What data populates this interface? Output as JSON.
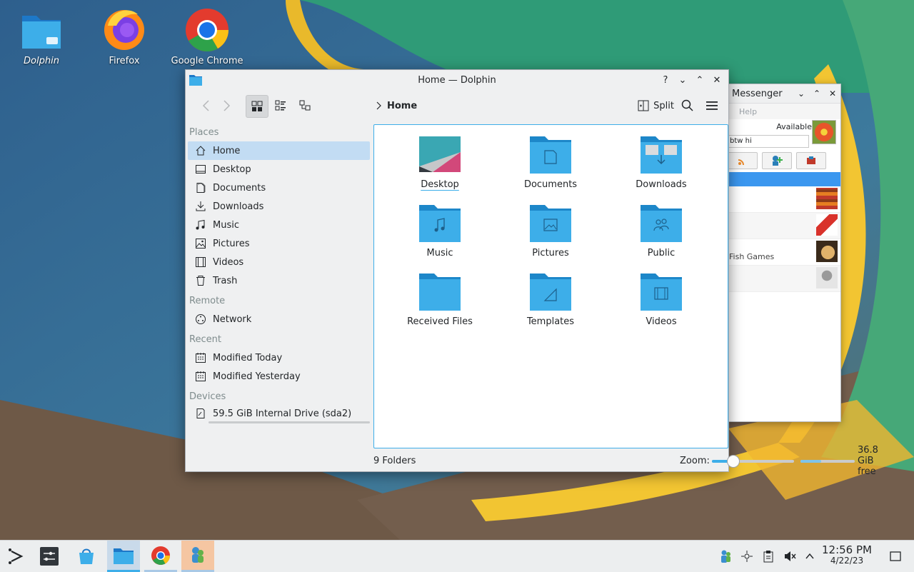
{
  "desktop": {
    "icons": [
      {
        "label": "Dolphin",
        "icon": "folder-icon"
      },
      {
        "label": "Firefox",
        "icon": "firefox-icon"
      },
      {
        "label": "Google Chrome",
        "icon": "chrome-icon"
      }
    ]
  },
  "dolphin": {
    "title": "Home — Dolphin",
    "window_buttons": {
      "help": "?",
      "minimize": "⌄",
      "maximize": "⌃",
      "close": "✕"
    },
    "toolbar": {
      "back_icon": "back-arrow-icon",
      "forward_icon": "forward-arrow-icon",
      "views": [
        "icons-view",
        "compact-view",
        "details-view"
      ],
      "active_view": "icons-view",
      "breadcrumb": "Home",
      "split_label": "Split"
    },
    "places": {
      "sections": {
        "places": "Places",
        "remote": "Remote",
        "recent": "Recent",
        "devices": "Devices"
      },
      "items": [
        {
          "label": "Home",
          "icon": "home-icon",
          "active": true
        },
        {
          "label": "Desktop",
          "icon": "desktop-icon"
        },
        {
          "label": "Documents",
          "icon": "documents-icon"
        },
        {
          "label": "Downloads",
          "icon": "downloads-icon"
        },
        {
          "label": "Music",
          "icon": "music-icon"
        },
        {
          "label": "Pictures",
          "icon": "pictures-icon"
        },
        {
          "label": "Videos",
          "icon": "videos-icon"
        },
        {
          "label": "Trash",
          "icon": "trash-icon"
        }
      ],
      "remote_items": [
        {
          "label": "Network",
          "icon": "network-icon"
        }
      ],
      "recent_items": [
        {
          "label": "Modified Today",
          "icon": "calendar-icon"
        },
        {
          "label": "Modified Yesterday",
          "icon": "calendar-icon"
        }
      ],
      "device_items": [
        {
          "label": "59.5 GiB Internal Drive (sda2)",
          "icon": "drive-icon"
        }
      ]
    },
    "files": [
      {
        "name": "Desktop",
        "icon": "desktop-folder-icon",
        "selected": true
      },
      {
        "name": "Documents",
        "icon": "documents-folder-icon"
      },
      {
        "name": "Downloads",
        "icon": "downloads-folder-icon"
      },
      {
        "name": "Music",
        "icon": "music-folder-icon"
      },
      {
        "name": "Pictures",
        "icon": "pictures-folder-icon"
      },
      {
        "name": "Public",
        "icon": "public-folder-icon"
      },
      {
        "name": "Received Files",
        "icon": "folder-icon"
      },
      {
        "name": "Templates",
        "icon": "templates-folder-icon"
      },
      {
        "name": "Videos",
        "icon": "videos-folder-icon"
      }
    ],
    "status": {
      "count": "9 Folders",
      "zoom_label": "Zoom:",
      "zoom_level": 0.25,
      "free_label": "36.8 GiB free",
      "used_fraction": 0.38
    }
  },
  "messenger": {
    "title": "Messenger",
    "menu_help": "Help",
    "status": "Available",
    "personal_message": "btw hi",
    "contact_name": "Fish Games"
  },
  "taskbar": {
    "launchers": [
      "application-launcher-icon",
      "settings-icon",
      "discover-icon",
      "dolphin-icon",
      "chrome-icon",
      "messenger-icon"
    ],
    "tray": [
      "messenger-tray-icon",
      "network-tray-icon",
      "clipboard-icon",
      "volume-muted-icon",
      "expand-tray-icon"
    ],
    "time": "12:56 PM",
    "date": "4/22/23"
  },
  "colors": {
    "accent": "#3daee9",
    "folder": "#3daee9",
    "selection": "#c2dcf3"
  }
}
